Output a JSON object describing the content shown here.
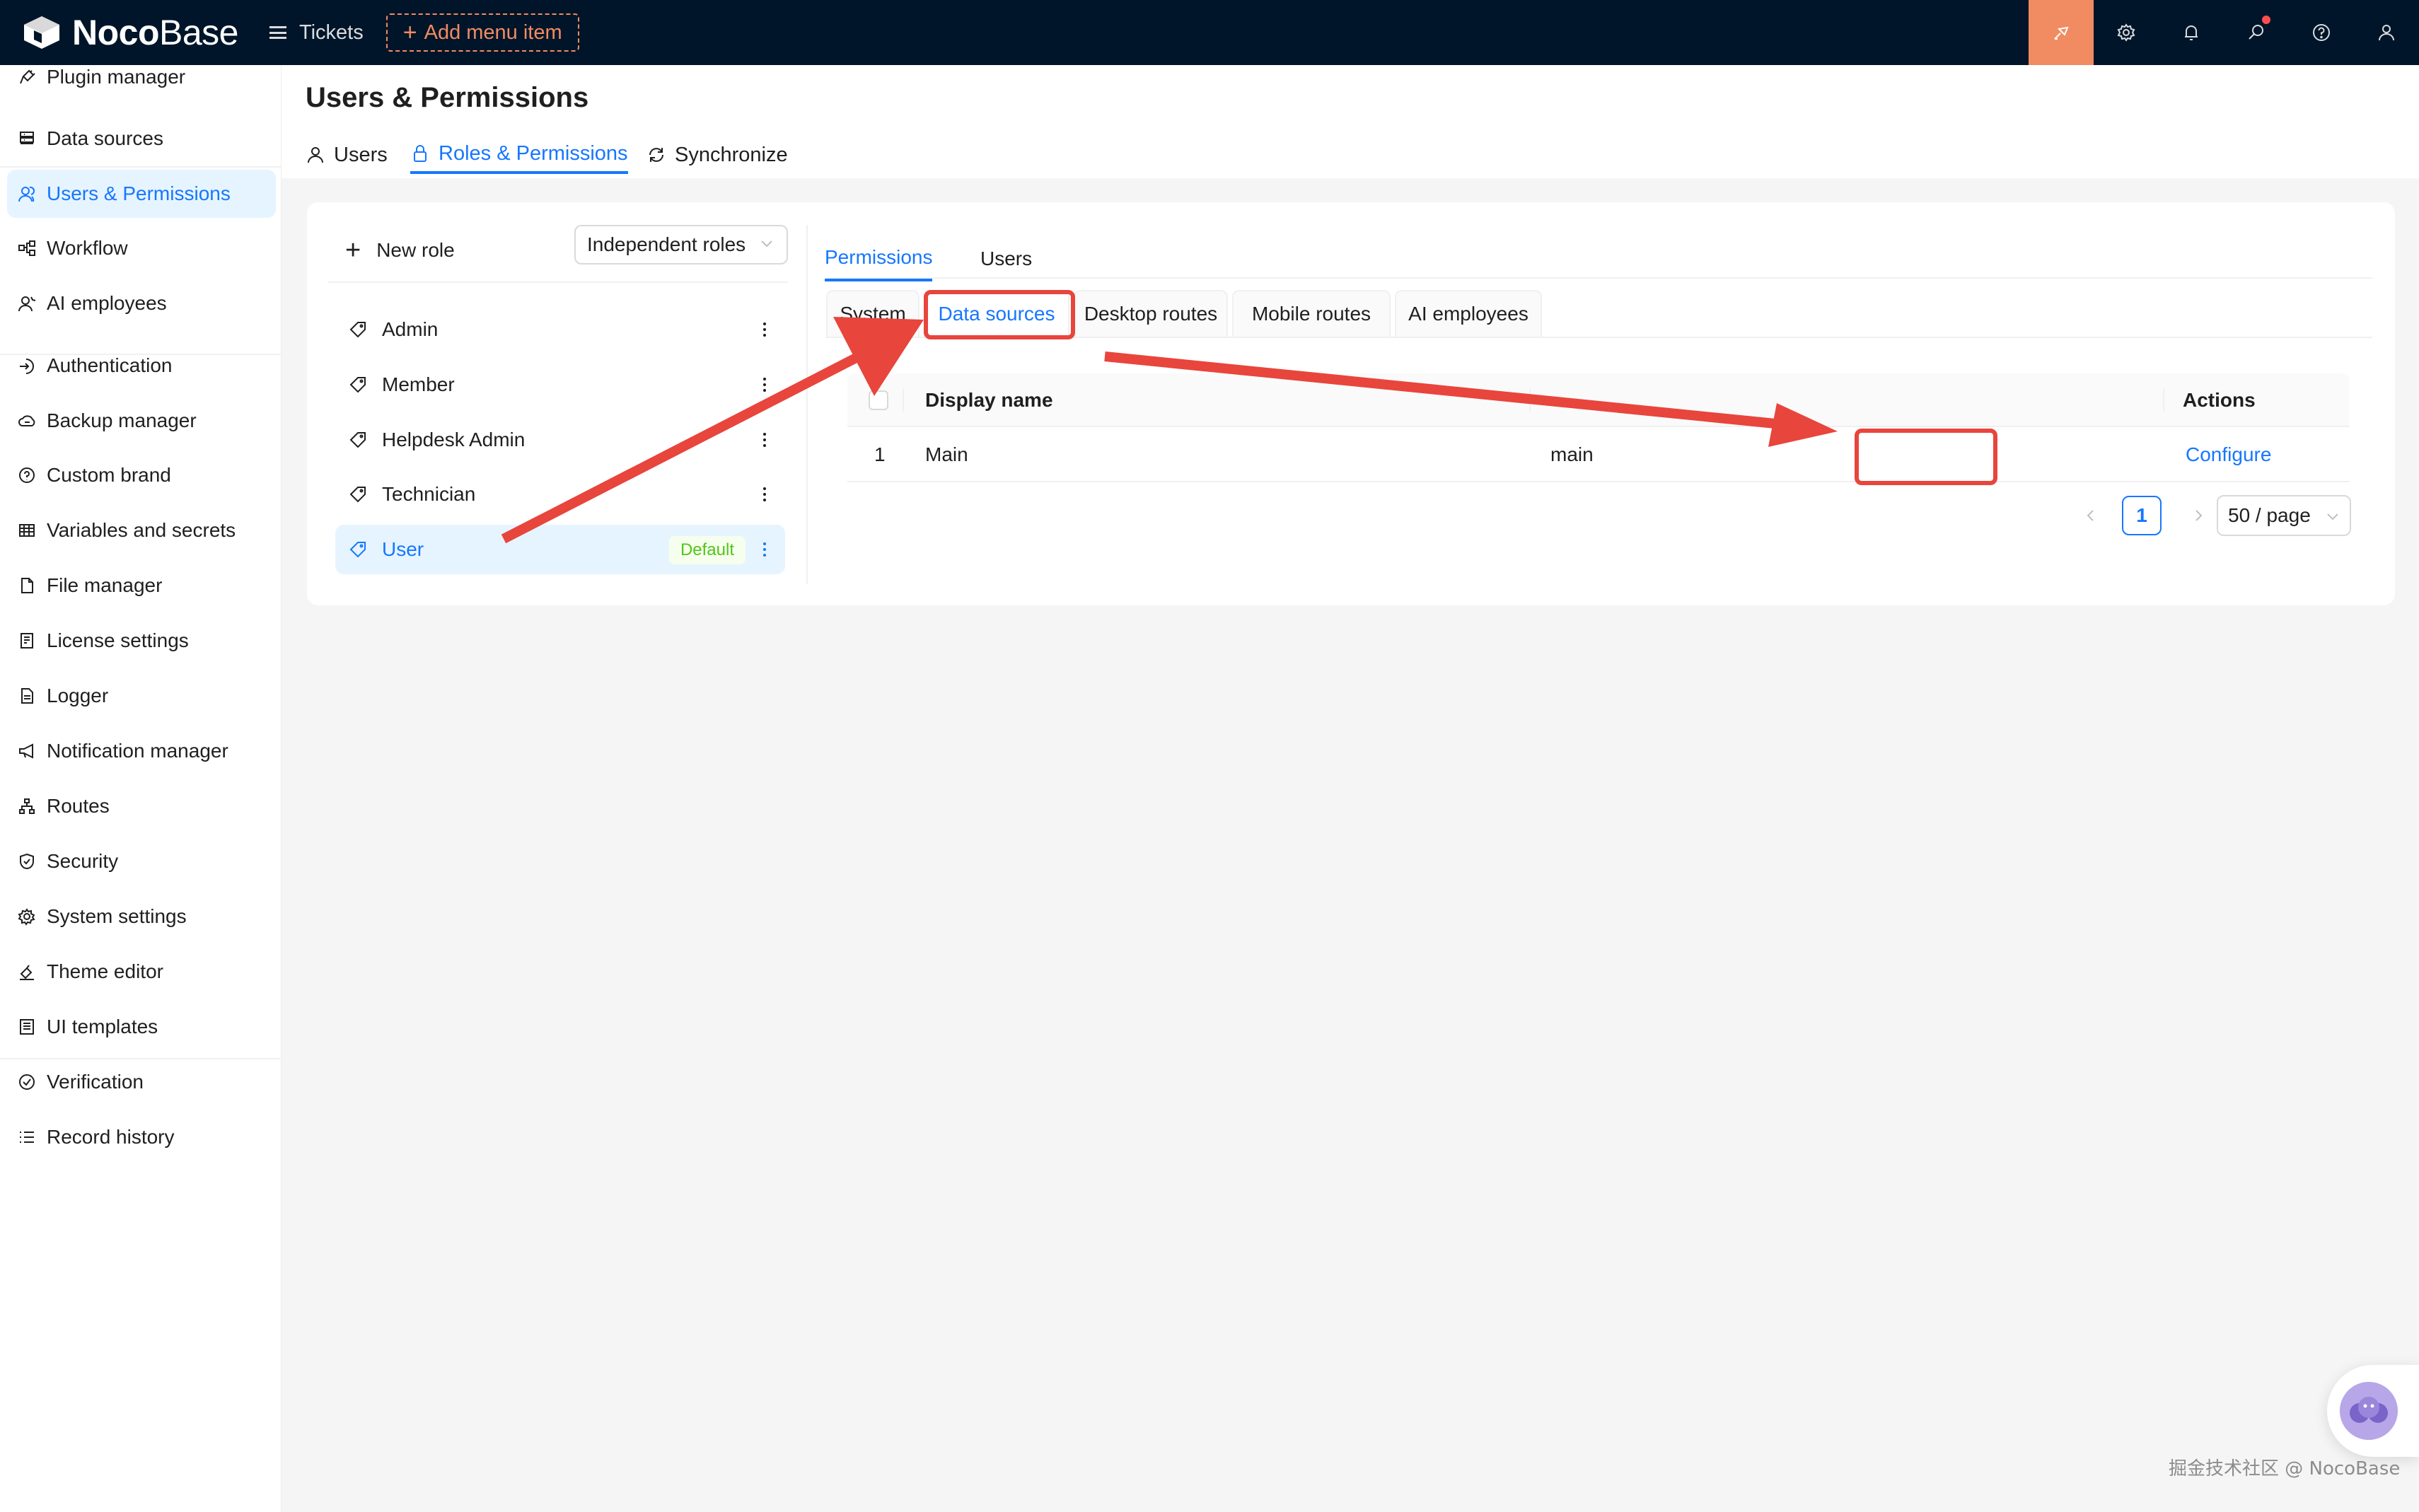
{
  "app": {
    "logo_bold": "Noco",
    "logo_light": "Base",
    "top_menu": "Tickets",
    "add_menu": "Add menu item"
  },
  "top_icons": [
    "theme-icon",
    "settings-icon",
    "bell-icon",
    "search-icon",
    "help-icon",
    "user-icon"
  ],
  "sidebar": {
    "items": [
      {
        "label": "Plugin manager",
        "icon": "plug-icon"
      },
      {
        "label": "Data sources",
        "icon": "database-icon"
      },
      {
        "label": "Users & Permissions",
        "icon": "users-icon"
      },
      {
        "label": "Workflow",
        "icon": "workflow-icon"
      },
      {
        "label": "AI employees",
        "icon": "ai-icon"
      },
      {
        "label": "Authentication",
        "icon": "login-icon"
      },
      {
        "label": "Backup manager",
        "icon": "cloud-icon"
      },
      {
        "label": "Custom brand",
        "icon": "brand-icon"
      },
      {
        "label": "Variables and secrets",
        "icon": "table-icon"
      },
      {
        "label": "File manager",
        "icon": "file-icon"
      },
      {
        "label": "License settings",
        "icon": "license-icon"
      },
      {
        "label": "Logger",
        "icon": "logger-icon"
      },
      {
        "label": "Notification manager",
        "icon": "megaphone-icon"
      },
      {
        "label": "Routes",
        "icon": "routes-icon"
      },
      {
        "label": "Security",
        "icon": "shield-icon"
      },
      {
        "label": "System settings",
        "icon": "gear-icon"
      },
      {
        "label": "Theme editor",
        "icon": "paint-icon"
      },
      {
        "label": "UI templates",
        "icon": "template-icon"
      },
      {
        "label": "Verification",
        "icon": "check-circle-icon"
      },
      {
        "label": "Record history",
        "icon": "list-icon"
      }
    ]
  },
  "page": {
    "title": "Users & Permissions",
    "tabs": [
      "Users",
      "Roles & Permissions",
      "Synchronize"
    ]
  },
  "roles": {
    "new_role": "New role",
    "mode_select": "Independent roles",
    "items": [
      "Admin",
      "Member",
      "Helpdesk Admin",
      "Technician",
      "User"
    ],
    "default_badge": "Default"
  },
  "permissions": {
    "tabs": [
      "Permissions",
      "Users"
    ],
    "sub_tabs": [
      "System",
      "Data sources",
      "Desktop routes",
      "Mobile routes",
      "AI employees"
    ],
    "columns": [
      "Display name",
      "Actions"
    ],
    "rows": [
      {
        "index": "1",
        "display_name": "Main",
        "name": "main",
        "action": "Configure"
      }
    ],
    "pagination": {
      "current": "1",
      "page_size": "50 / page"
    }
  },
  "annotation_color": "#e8453c",
  "accent_color": "#1677ff",
  "watermark": "掘金技术社区 @ NocoBase"
}
